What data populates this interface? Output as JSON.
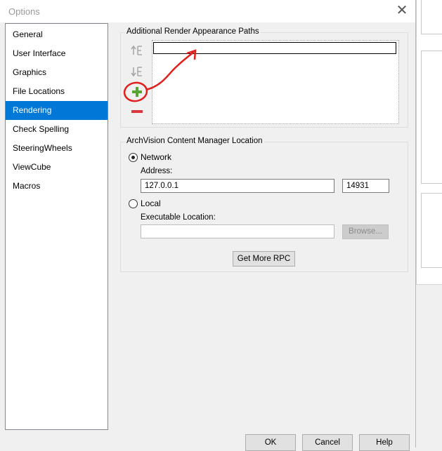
{
  "window": {
    "title": "Options",
    "close_glyph": "✕"
  },
  "nav": {
    "items": [
      {
        "label": "General"
      },
      {
        "label": "User Interface"
      },
      {
        "label": "Graphics"
      },
      {
        "label": "File Locations"
      },
      {
        "label": "Rendering"
      },
      {
        "label": "Check Spelling"
      },
      {
        "label": "SteeringWheels"
      },
      {
        "label": "ViewCube"
      },
      {
        "label": "Macros"
      }
    ],
    "selected": "Rendering"
  },
  "paths_group": {
    "title": "Additional Render Appearance Paths",
    "icons": [
      "move-up-icon",
      "move-down-icon",
      "add-icon",
      "remove-icon"
    ],
    "rows": [
      ""
    ]
  },
  "archvision_group": {
    "title": "ArchVision Content Manager Location",
    "network_label": "Network",
    "network_selected": true,
    "address_label": "Address:",
    "address_value": "127.0.0.1",
    "port_value": "14931",
    "local_label": "Local",
    "local_selected": false,
    "executable_label": "Executable Location:",
    "executable_value": "",
    "browse_label": "Browse...",
    "get_more_label": "Get More RPC"
  },
  "footer": {
    "ok_label": "OK",
    "cancel_label": "Cancel",
    "help_label": "Help"
  },
  "colors": {
    "selection": "#0078d7",
    "annotation": "#e0201c",
    "add_icon": "#55a630",
    "remove_icon": "#d9363e"
  }
}
